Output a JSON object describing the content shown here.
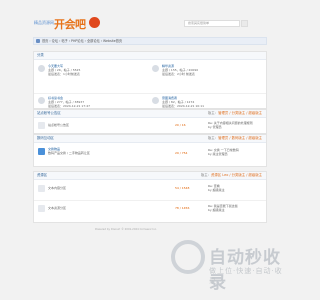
{
  "header": {
    "logo_sub": "精品资源网",
    "logo_main": "开会吧",
    "search_placeholder": "搜索其实很简单"
  },
  "nav": {
    "breadcrumb": "首页 › 论坛 › 帖子 › PHP论坛 › 全部论坛 › Website首页"
  },
  "section1": {
    "title": "分类",
    "forums": [
      {
        "name": "今天要大写",
        "stats": "主题 / 2K，帖子 / 5525",
        "last": "最后发表：1小时前发表"
      },
      {
        "name": "精华资源",
        "stats": "主题 / 155，帖子 / 20090",
        "last": "最后发表：2小时 前发表"
      },
      {
        "name": "好书读书会",
        "stats": "主题 / 277，帖子 / 38937",
        "last": "最后发表：2024-12-21 17:47"
      },
      {
        "name": "意图消费者",
        "stats": "主题 / 82，帖子 / 1274",
        "last": "最后发表：2024-12-21 10:11"
      },
      {
        "name": "最新发表区",
        "stats": "主题 / 45，帖子 / 228",
        "last": "最后发表：2024-12-13 3:23"
      },
      {
        "name": "世代变化",
        "stats": "主题 / 93，帖子 / 1227",
        "last": "最后发表：2023-08-25 16:21"
      }
    ]
  },
  "section2": {
    "title": "站点帐号公告区",
    "moderator_label": "版主：",
    "moderators": "管理员 / 分类版主 / 超级版主",
    "threads": [
      {
        "title": "站点帐号公告区",
        "count": "20 / 16",
        "last": "Re: 关于内容相关问题的处理规则",
        "by": "by 管理员"
      }
    ]
  },
  "section3": {
    "title": "数码互动区",
    "moderator_label": "版主：",
    "moderators": "管理员 / 数码版主 / 超级版主",
    "threads": [
      {
        "title": "交换物品",
        "desc": "数码产品交换 / 二手物品转让区",
        "count": "29 / 754",
        "last": "Re: 交换 一下日常数码",
        "by": "by 版主管理员"
      }
    ]
  },
  "section4": {
    "title": "资源区",
    "moderator_label": "版主：",
    "moderators": "资源区 Leo / 分类版主 / 超级版主",
    "threads": [
      {
        "title": "文本内容分区",
        "count": "54 / 1548",
        "last": "Re: 查看",
        "by": "by 超级版主"
      },
      {
        "title": "文本资源分区",
        "count": "78 / 1456",
        "last": "Re: 我是否能下载这些",
        "by": "by 超级版主"
      }
    ]
  },
  "footer": {
    "text": "Powered by Discuz! © 2001-2024 Comsenz Inc."
  },
  "watermark": {
    "main": "自动秒收录",
    "sub": "做上位·快速·自动·收录"
  }
}
